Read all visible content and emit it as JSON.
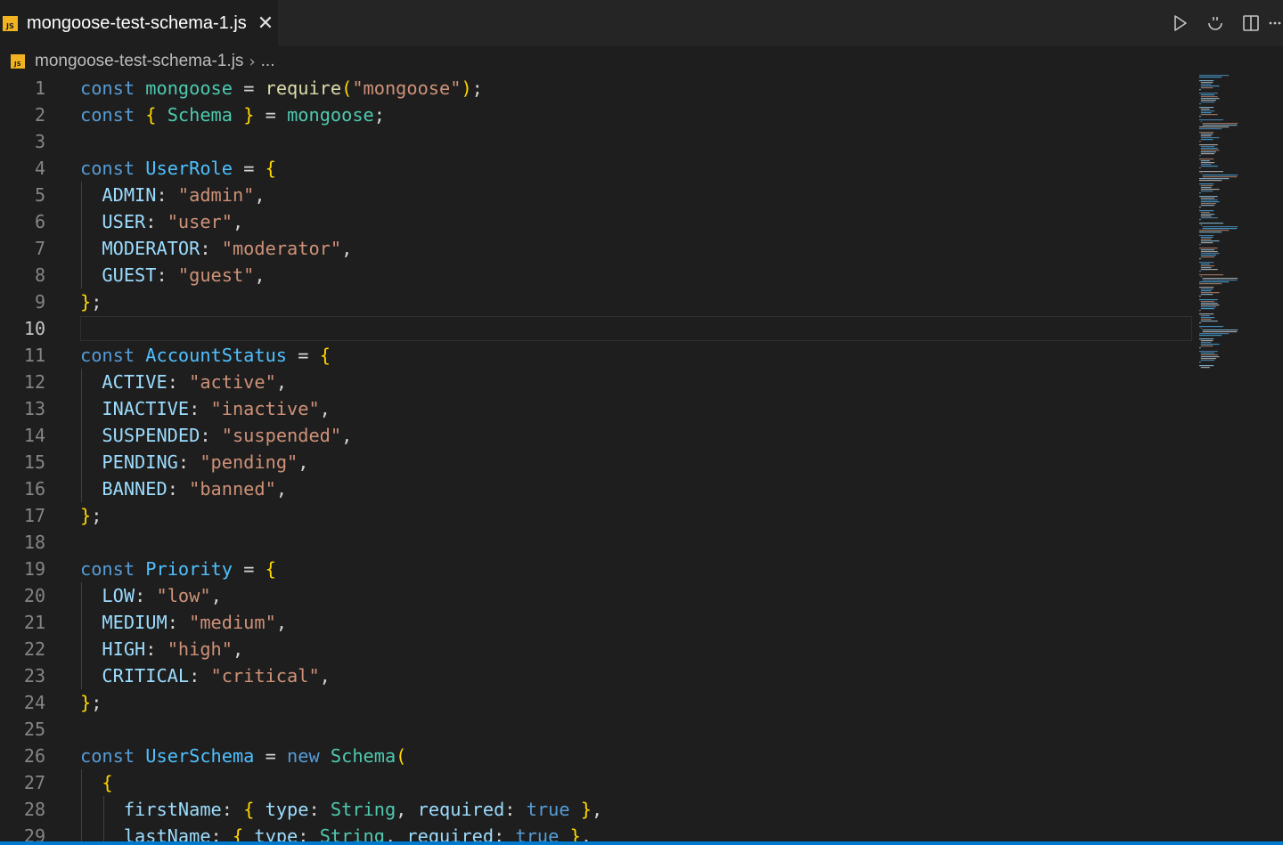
{
  "tab": {
    "title": "mongoose-test-schema-1.js",
    "language_badge": "JS",
    "close_glyph": "✕"
  },
  "actions": [
    {
      "name": "run-icon"
    },
    {
      "name": "open-changes-icon"
    },
    {
      "name": "split-editor-icon"
    },
    {
      "name": "more-actions-icon"
    }
  ],
  "breadcrumb": {
    "file": "mongoose-test-schema-1.js",
    "separator": "›",
    "more": "..."
  },
  "editor": {
    "active_line": 10,
    "lines": [
      "const mongoose = require(\"mongoose\");",
      "const { Schema } = mongoose;",
      "",
      "const UserRole = {",
      "  ADMIN: \"admin\",",
      "  USER: \"user\",",
      "  MODERATOR: \"moderator\",",
      "  GUEST: \"guest\",",
      "};",
      "",
      "const AccountStatus = {",
      "  ACTIVE: \"active\",",
      "  INACTIVE: \"inactive\",",
      "  SUSPENDED: \"suspended\",",
      "  PENDING: \"pending\",",
      "  BANNED: \"banned\",",
      "};",
      "",
      "const Priority = {",
      "  LOW: \"low\",",
      "  MEDIUM: \"medium\",",
      "  HIGH: \"high\",",
      "  CRITICAL: \"critical\",",
      "};",
      "",
      "const UserSchema = new Schema(",
      "  {",
      "    firstName: { type: String, required: true },",
      "    lastName: { type: String, required: true },"
    ]
  },
  "colors": {
    "keyword": "#569cd6",
    "variable": "#4fc1ff",
    "type": "#4ec9b0",
    "function": "#dcdcaa",
    "string": "#ce9178",
    "property": "#9cdcfe",
    "bracket_level_1": "#ffd700",
    "bracket_level_2": "#da70d6",
    "js_badge": "#f1b320",
    "status_bar": "#007acc"
  }
}
